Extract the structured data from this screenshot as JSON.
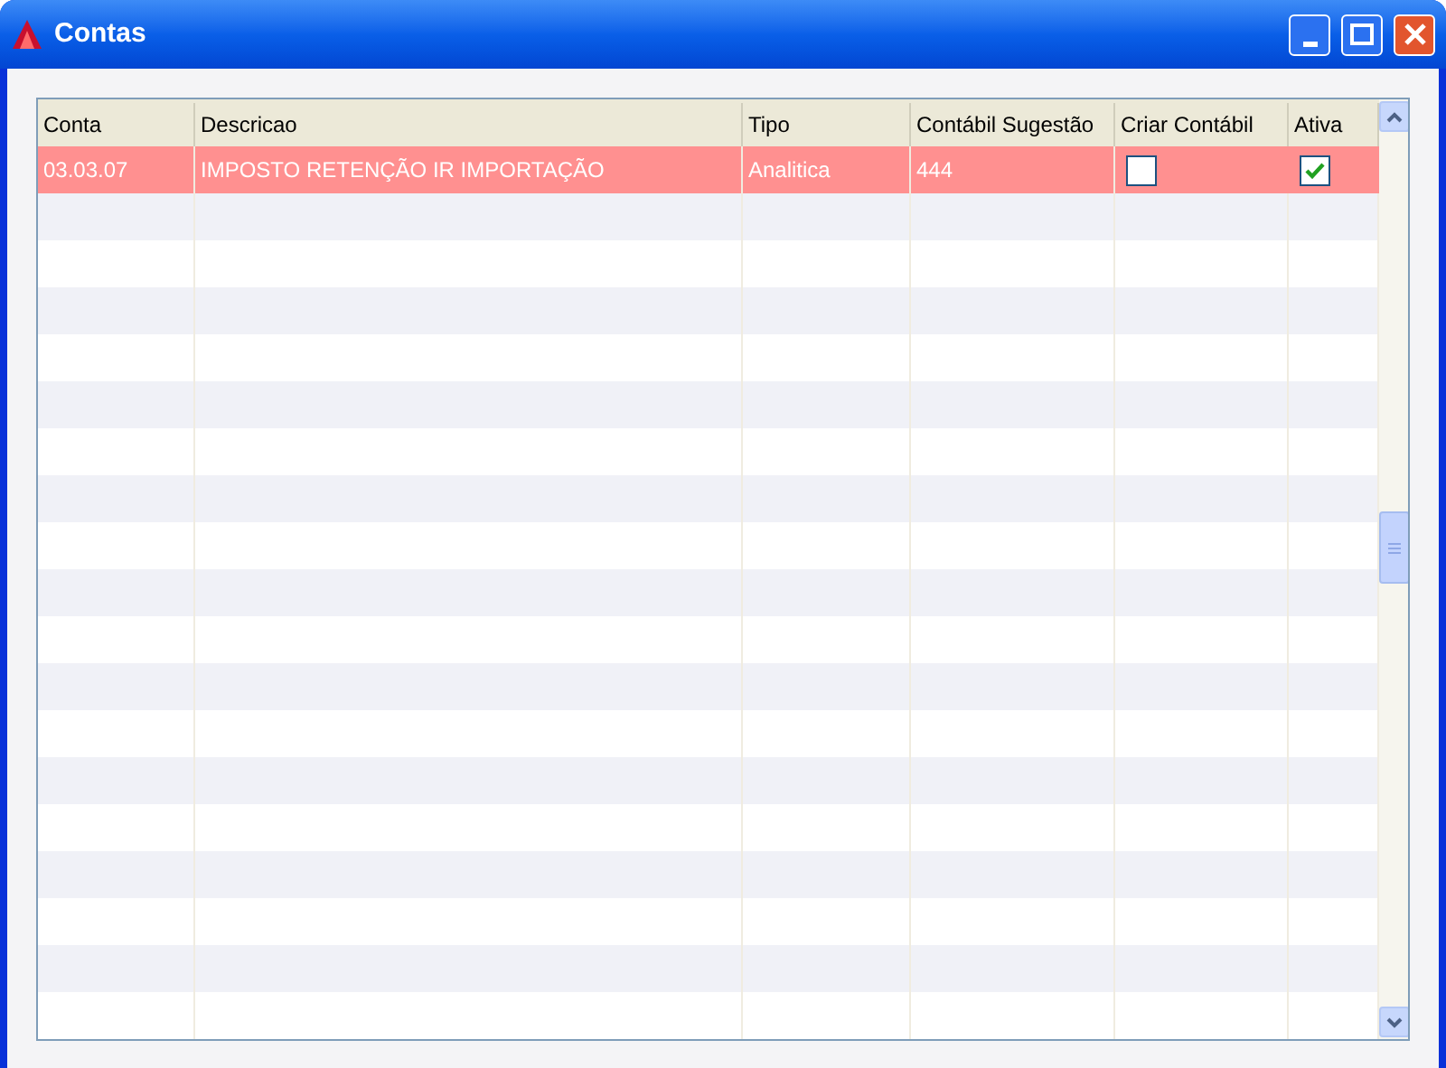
{
  "window": {
    "title": "Contas"
  },
  "table": {
    "columns": [
      "Conta",
      "Descricao",
      "Tipo",
      "Contábil Sugestão",
      "Criar Contábil",
      "Ativa"
    ],
    "rows": [
      {
        "conta": "03.03.07",
        "descricao": "IMPOSTO RETENÇÃO IR IMPORTAÇÃO",
        "tipo": "Analitica",
        "contabil_sugestao": "444",
        "criar_contabil": false,
        "ativa": true,
        "selected": true
      }
    ]
  }
}
